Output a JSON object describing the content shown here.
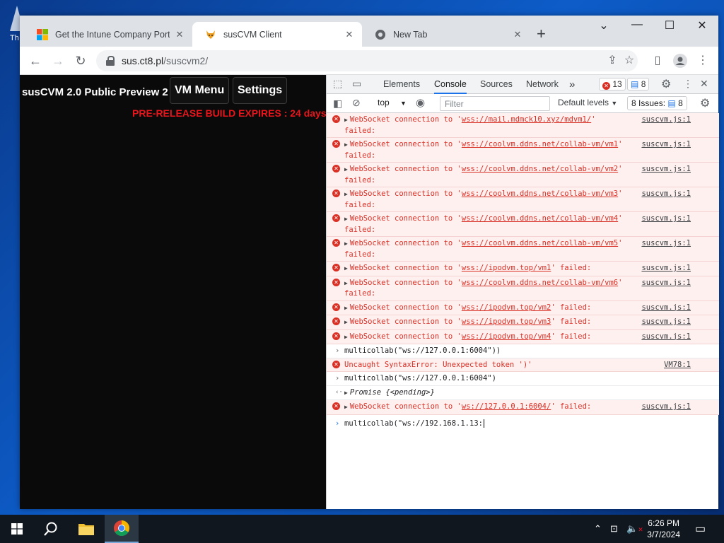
{
  "desktop": {
    "icon_label": "Th"
  },
  "browser": {
    "tabs": [
      {
        "title": "Get the Intune Company Portal a",
        "close": "✕"
      },
      {
        "title": "susCVM Client",
        "close": "✕"
      },
      {
        "title": "New Tab",
        "close": "✕"
      }
    ],
    "new_tab": "+",
    "window_controls": {
      "dropdown": "⌄",
      "minimize": "—",
      "maximize": "☐",
      "close": "✕"
    },
    "url_host": "sus.ct8.pl",
    "url_path": "/suscvm2/"
  },
  "page": {
    "brand": "susCVM 2.0 Public Preview 2",
    "vm_menu": "VM Menu",
    "settings": "Settings",
    "expire_notice": "PRE-RELEASE BUILD EXPIRES : 24 days"
  },
  "devtools": {
    "tabs": [
      "Elements",
      "Console",
      "Sources",
      "Network"
    ],
    "more": "»",
    "error_count": "13",
    "message_count": "8",
    "context": "top",
    "filter_placeholder": "Filter",
    "levels": "Default levels",
    "issues_label": "8 Issues:",
    "issues_count": "8"
  },
  "console": [
    {
      "type": "error",
      "pre": "WebSocket connection to '",
      "url": "wss://mail.mdmck10.xyz/mdvm1/",
      "post": "'",
      "line2": "failed:",
      "src": "suscvm.js:1"
    },
    {
      "type": "error",
      "pre": "WebSocket connection to '",
      "url": "wss://coolvm.ddns.net/collab-vm/vm1",
      "post": "'",
      "line2": "failed:",
      "src": "suscvm.js:1"
    },
    {
      "type": "error",
      "pre": "WebSocket connection to '",
      "url": "wss://coolvm.ddns.net/collab-vm/vm2",
      "post": "'",
      "line2": "failed:",
      "src": "suscvm.js:1"
    },
    {
      "type": "error",
      "pre": "WebSocket connection to '",
      "url": "wss://coolvm.ddns.net/collab-vm/vm3",
      "post": "'",
      "line2": "failed:",
      "src": "suscvm.js:1"
    },
    {
      "type": "error",
      "pre": "WebSocket connection to '",
      "url": "wss://coolvm.ddns.net/collab-vm/vm4",
      "post": "'",
      "line2": "failed:",
      "src": "suscvm.js:1"
    },
    {
      "type": "error",
      "pre": "WebSocket connection to '",
      "url": "wss://coolvm.ddns.net/collab-vm/vm5",
      "post": "'",
      "line2": "failed:",
      "src": "suscvm.js:1"
    },
    {
      "type": "error",
      "pre": "WebSocket connection to '",
      "url": "wss://ipodvm.top/vm1",
      "post": "' failed:",
      "line2": "",
      "src": "suscvm.js:1"
    },
    {
      "type": "error",
      "pre": "WebSocket connection to '",
      "url": "wss://coolvm.ddns.net/collab-vm/vm6",
      "post": "'",
      "line2": "failed:",
      "src": "suscvm.js:1"
    },
    {
      "type": "error",
      "pre": "WebSocket connection to '",
      "url": "wss://ipodvm.top/vm2",
      "post": "' failed:",
      "line2": "",
      "src": "suscvm.js:1"
    },
    {
      "type": "error",
      "pre": "WebSocket connection to '",
      "url": "wss://ipodvm.top/vm3",
      "post": "' failed:",
      "line2": "",
      "src": "suscvm.js:1"
    },
    {
      "type": "error",
      "pre": "WebSocket connection to '",
      "url": "wss://ipodvm.top/vm4",
      "post": "' failed:",
      "line2": "",
      "src": "suscvm.js:1"
    }
  ],
  "console_tail": {
    "input1": "multicollab(\"ws://127.0.0.1:6004\"))",
    "syntax_error": "Uncaught SyntaxError: Unexpected token ')'",
    "syntax_src": "VM78:1",
    "input2": "multicollab(\"ws://127.0.0.1:6004\")",
    "promise": "Promise {<pending>}",
    "ws_pre": "WebSocket connection to '",
    "ws_url": "ws://127.0.0.1:6004/",
    "ws_post": "' failed:",
    "ws_src": "suscvm.js:1",
    "current_input": "multicollab(\"ws://192.168.1.13:"
  },
  "taskbar": {
    "time": "6:26 PM",
    "date": "3/7/2024"
  }
}
